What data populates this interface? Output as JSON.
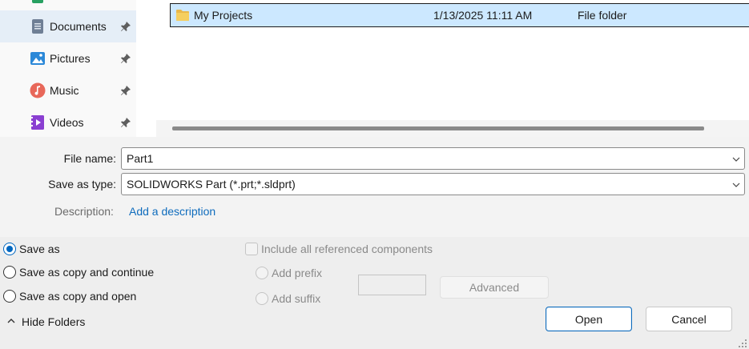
{
  "nav": {
    "items": [
      {
        "label": "Documents",
        "icon": "documents-icon",
        "pinned": true,
        "selected": true
      },
      {
        "label": "Pictures",
        "icon": "pictures-icon",
        "pinned": true,
        "selected": false
      },
      {
        "label": "Music",
        "icon": "music-icon",
        "pinned": true,
        "selected": false
      },
      {
        "label": "Videos",
        "icon": "videos-icon",
        "pinned": true,
        "selected": false
      }
    ]
  },
  "files": {
    "rows": [
      {
        "name": "My Projects",
        "date_modified": "1/13/2025 11:11 AM",
        "type": "File folder",
        "icon": "folder-icon",
        "selected": true
      }
    ]
  },
  "form": {
    "file_name_label": "File name:",
    "file_name_value": "Part1",
    "save_type_label": "Save as type:",
    "save_type_value": "SOLIDWORKS Part (*.prt;*.sldprt)",
    "description_label": "Description:",
    "description_link": "Add a description"
  },
  "options": {
    "save_as": "Save as",
    "save_as_copy_continue": "Save as copy and continue",
    "save_as_copy_open": "Save as copy and open",
    "selected": "Save as",
    "include_referenced": "Include all referenced components",
    "add_prefix": "Add prefix",
    "add_suffix": "Add suffix",
    "advanced": "Advanced"
  },
  "footer": {
    "hide_folders": "Hide Folders",
    "open": "Open",
    "cancel": "Cancel"
  },
  "colors": {
    "accent": "#0067c0",
    "link": "#0f6cbd",
    "selection": "#cce8ff",
    "nav_selected": "#e5eef7",
    "folder": "#f0c040"
  }
}
